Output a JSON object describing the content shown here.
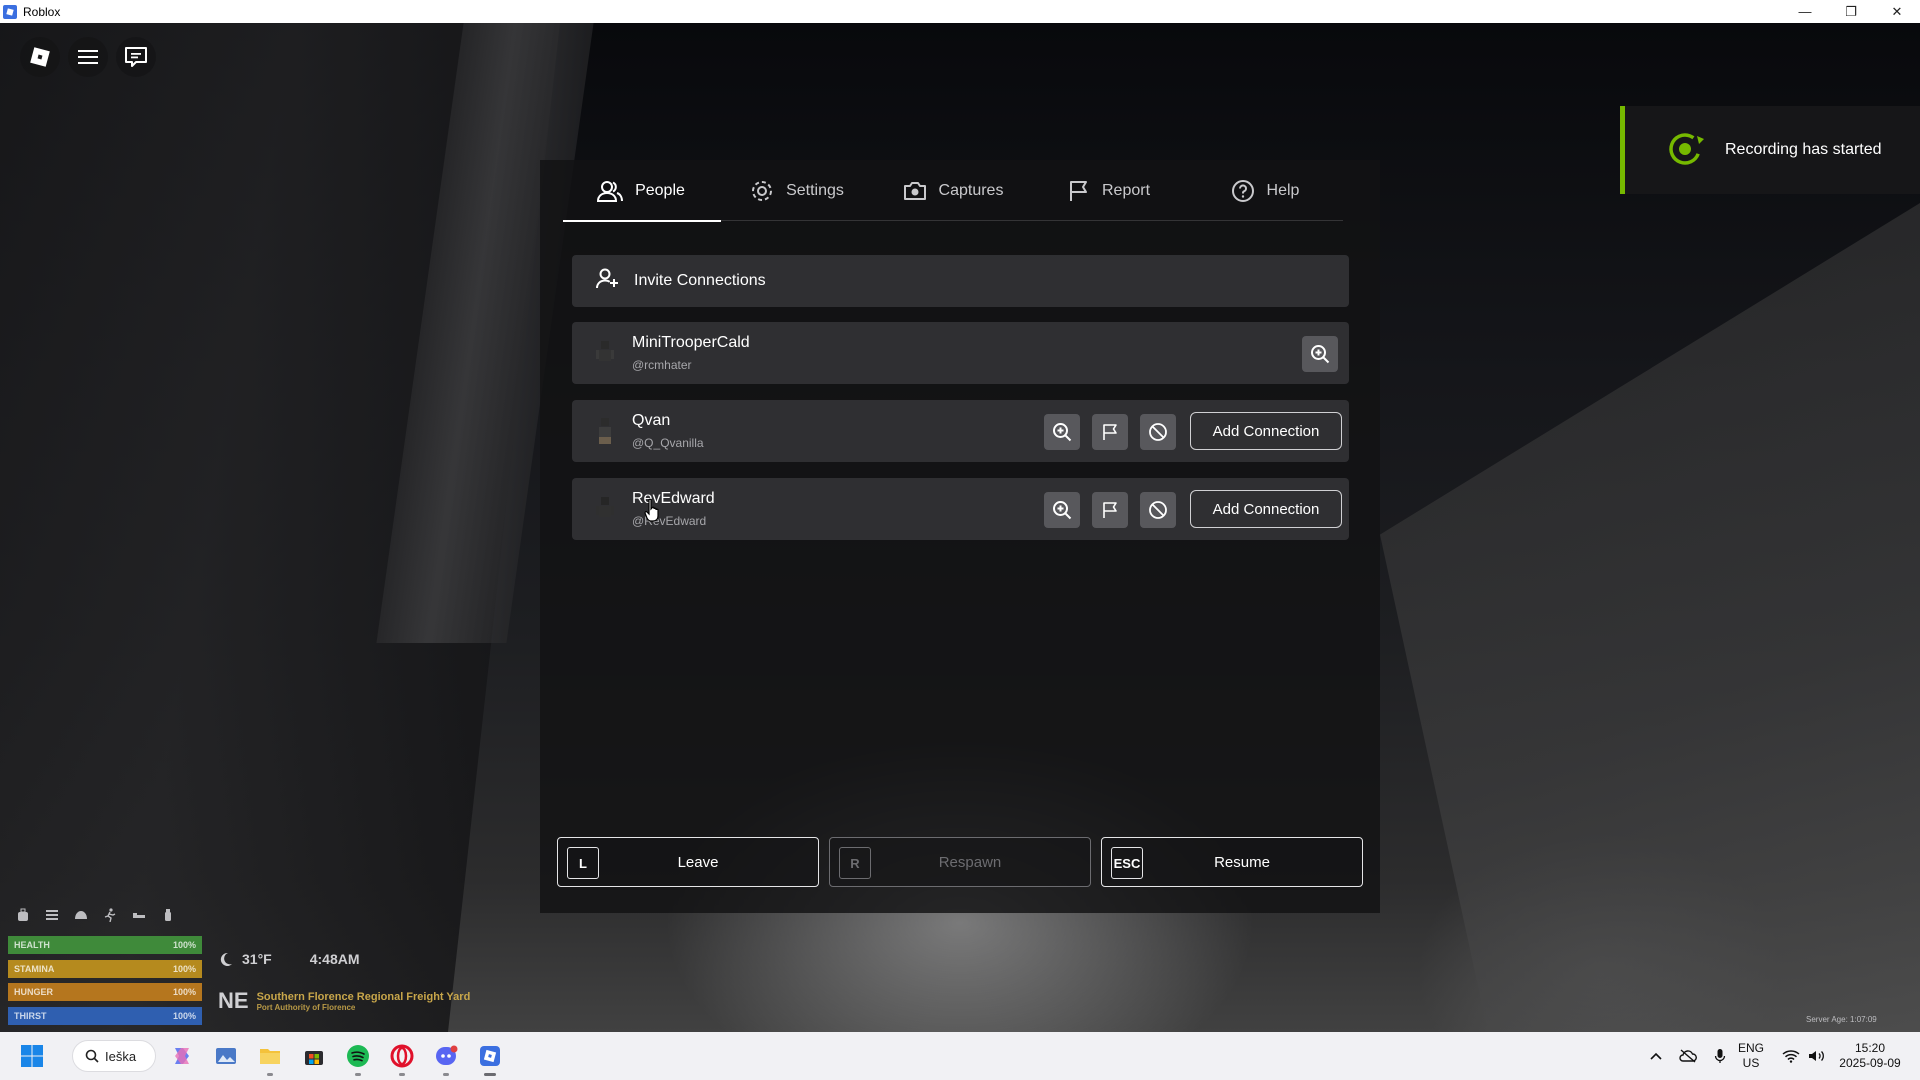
{
  "window": {
    "title": "Roblox",
    "controls": {
      "minimize": "—",
      "maximize": "❐",
      "close": "✕"
    }
  },
  "toast": {
    "text": "Recording has started",
    "accent": "#76b900"
  },
  "menu": {
    "tabs": [
      {
        "label": "People",
        "icon": "people-icon",
        "active": true
      },
      {
        "label": "Settings",
        "icon": "gear-icon",
        "active": false
      },
      {
        "label": "Captures",
        "icon": "camera-icon",
        "active": false
      },
      {
        "label": "Report",
        "icon": "flag-icon",
        "active": false
      },
      {
        "label": "Help",
        "icon": "help-icon",
        "active": false
      }
    ],
    "invite": {
      "label": "Invite Connections"
    },
    "players": [
      {
        "name": "MiniTrooperCald",
        "handle": "@rcmhater",
        "add_label": ""
      },
      {
        "name": "Qvan",
        "handle": "@Q_Qvanilla",
        "add_label": "Add Connection"
      },
      {
        "name": "RevEdward",
        "handle": "@RevEdward",
        "add_label": "Add Connection"
      }
    ],
    "bottom": {
      "leave": {
        "key": "L",
        "label": "Leave"
      },
      "respawn": {
        "key": "R",
        "label": "Respawn"
      },
      "resume": {
        "key": "ESC",
        "label": "Resume"
      }
    }
  },
  "hud": {
    "stats": [
      {
        "label": "HEALTH",
        "value": "100%",
        "level": 1.0,
        "color": "#3f8a3a"
      },
      {
        "label": "STAMINA",
        "value": "100%",
        "level": 1.0,
        "color": "#b58a1e"
      },
      {
        "label": "HUNGER",
        "value": "100%",
        "level": 1.0,
        "color": "#b5761e"
      },
      {
        "label": "THIRST",
        "value": "100%",
        "level": 1.0,
        "color": "#2f5fb0"
      }
    ],
    "temperature": "31°F",
    "time": "4:48AM",
    "direction": "NE",
    "location": "Southern Florence Regional Freight Yard",
    "location_sub": "Port Authority of Florence",
    "server_age": "Server Age: 1:07:09"
  },
  "taskbar": {
    "search_label": "Ieška",
    "apps": [
      "windows-start-icon",
      "copilot-icon",
      "photos-icon",
      "file-explorer-icon",
      "microsoft-store-icon",
      "spotify-icon",
      "opera-icon",
      "discord-icon",
      "roblox-icon"
    ],
    "lang_top": "ENG",
    "lang_bottom": "US",
    "clock_time": "15:20",
    "clock_date": "2025-09-09"
  }
}
